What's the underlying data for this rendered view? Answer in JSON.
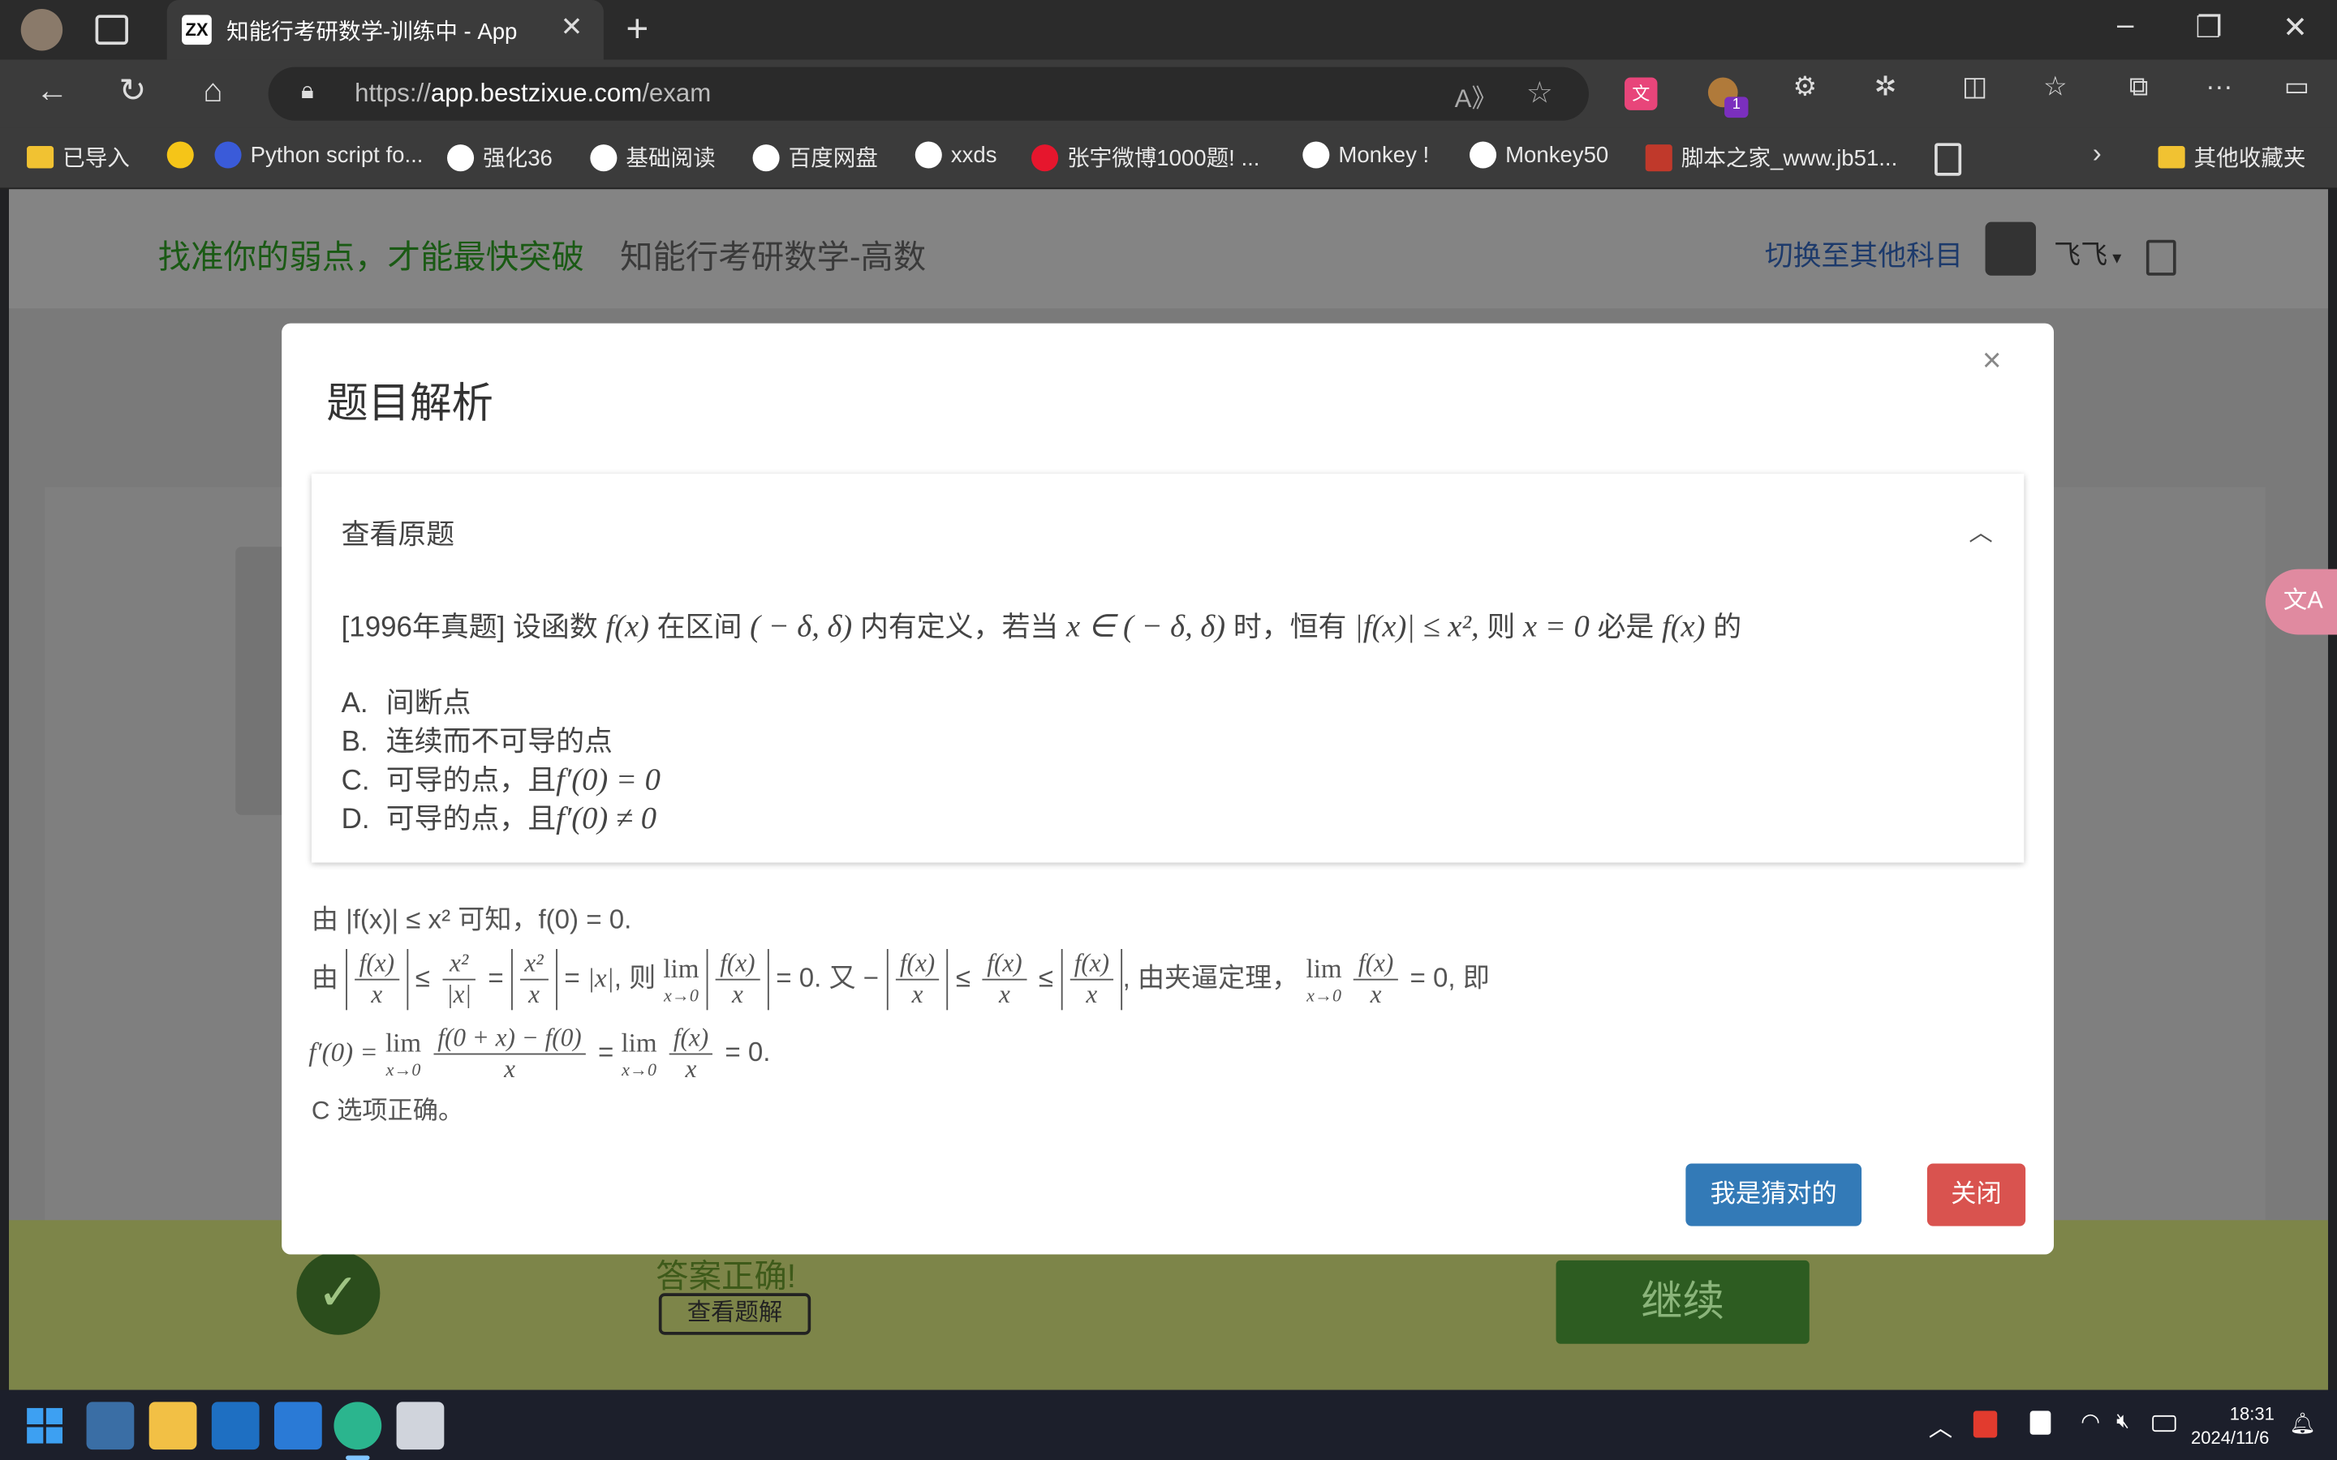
{
  "browser": {
    "tab_title": "知能行考研数学-训练中 - App",
    "tab_favicon": "ZX",
    "url_prefix": "https://",
    "url_domain": "app.bestzixue.com",
    "url_path": "/exam"
  },
  "bookmarks": [
    {
      "label": "已导入",
      "icon": "folder-icon"
    },
    {
      "label": "Python script fo...",
      "icon": "site-icon"
    },
    {
      "label": "强化36",
      "icon": "site-icon"
    },
    {
      "label": "基础阅读",
      "icon": "site-icon"
    },
    {
      "label": "百度网盘",
      "icon": "site-icon"
    },
    {
      "label": "xxds",
      "icon": "site-icon"
    },
    {
      "label": "张宇微博1000题! ...",
      "icon": "weibo-icon"
    },
    {
      "label": "Monkey !",
      "icon": "site-icon"
    },
    {
      "label": "Monkey50",
      "icon": "site-icon"
    },
    {
      "label": "脚本之家_www.jb51...",
      "icon": "site-icon"
    }
  ],
  "other_bookmarks": "其他收藏夹",
  "extension_badge": "1",
  "header": {
    "slogan": "找准你的弱点，才能最快突破",
    "subject_title": "知能行考研数学-高数",
    "switch_subject": "切换至其他科目",
    "user_name": "飞飞"
  },
  "modal": {
    "title": "题目解析",
    "close_glyph": "×",
    "card_header": "查看原题",
    "question": {
      "prefix": "[1996年真题] 设函数",
      "part1": "在区间",
      "part2": "内有定义，若当",
      "part3": "时，恒有",
      "part4": "则",
      "part5": "必是",
      "part6": "的",
      "math_fx": "f(x)",
      "math_interval": "( − δ, δ)",
      "math_x_in": "x ∈ ( − δ, δ)",
      "math_ineq": "|f(x)| ≤ x²,",
      "math_x0": "x = 0"
    },
    "options": [
      {
        "letter": "A.",
        "text": "间断点",
        "math": ""
      },
      {
        "letter": "B.",
        "text": "连续而不可导的点",
        "math": ""
      },
      {
        "letter": "C.",
        "text": "可导的点，且",
        "math": "f′(0) = 0"
      },
      {
        "letter": "D.",
        "text": "可导的点，且",
        "math": "f′(0) ≠ 0"
      }
    ],
    "solution": {
      "line1": "由 |f(x)| ≤ x² 可知，f(0) = 0.",
      "line2_start": "由",
      "line2_then": ", 则",
      "line2_also": "= 0. 又 −",
      "line2_squeeze": ", 由夹逼定理，",
      "line2_end": "= 0, 即",
      "line3_lhs": "f′(0) =",
      "line3_eq": "=",
      "line3_end": "= 0.",
      "line4": "C 选项正确。",
      "lim_word": "lim",
      "lim_sub": "x→0"
    },
    "guess_button": "我是猜对的",
    "close_button": "关闭"
  },
  "result_bar": {
    "answer_correct": "答案正确!",
    "view_solution": "查看题解",
    "continue": "继续",
    "check_glyph": "✓"
  },
  "taskbar": {
    "time": "18:31",
    "date": "2024/11/6"
  },
  "colors": {
    "primary": "#337ab7",
    "danger": "#d9534f",
    "slogan_green": "#1a5a14"
  }
}
